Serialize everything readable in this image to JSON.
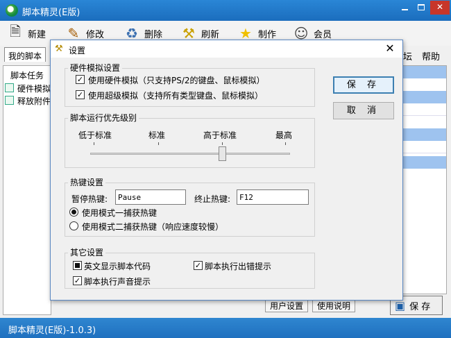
{
  "main_window": {
    "title": "脚本精灵(E版)",
    "toolbar": [
      {
        "label": "新建",
        "icon": "new-doc-icon"
      },
      {
        "label": "修改",
        "icon": "edit-pencil-icon"
      },
      {
        "label": "删除",
        "icon": "recycle-bin-icon"
      },
      {
        "label": "刷新",
        "icon": "broom-icon"
      },
      {
        "label": "制作",
        "icon": "star-icon"
      },
      {
        "label": "会员",
        "icon": "member-icon"
      }
    ],
    "tab_my_scripts": "我的脚本",
    "menu_right": [
      "坛",
      "帮助"
    ],
    "tree": [
      "脚本任务",
      "硬件模拟",
      "释放附件"
    ],
    "bottom_tabs": [
      "用户设置",
      "使用说明"
    ],
    "save_label": "保 存",
    "status_text": "脚本精灵(E版)-1.0.3)"
  },
  "dialog": {
    "title": "设置",
    "hardware_group": {
      "title": "硬件模拟设置",
      "options": [
        {
          "label": "使用硬件模拟（只支持PS/2的键盘、鼠标模拟）",
          "checked": true
        },
        {
          "label": "使用超级模拟（支持所有类型键盘、鼠标模拟）",
          "checked": true
        }
      ]
    },
    "priority_group": {
      "title": "脚本运行优先级别",
      "levels": [
        "低于标准",
        "标准",
        "高于标准",
        "最高"
      ],
      "selected_level": "高于标准"
    },
    "hotkey_group": {
      "title": "热键设置",
      "pause_label": "暂停热键:",
      "pause_value": "Pause",
      "stop_label": "终止热键:",
      "stop_value": "F12",
      "modes": [
        {
          "label": "使用模式一捕获热键",
          "selected": true
        },
        {
          "label": "使用模式二捕获热键（响应速度较慢）",
          "selected": false
        }
      ]
    },
    "other_group": {
      "title": "其它设置",
      "options": [
        {
          "label": "英文显示脚本代码",
          "state": "indeterminate"
        },
        {
          "label": "脚本执行出错提示",
          "state": "checked"
        },
        {
          "label": "脚本执行声音提示",
          "state": "checked"
        }
      ]
    },
    "save_button": "保 存",
    "cancel_button": "取 消"
  }
}
